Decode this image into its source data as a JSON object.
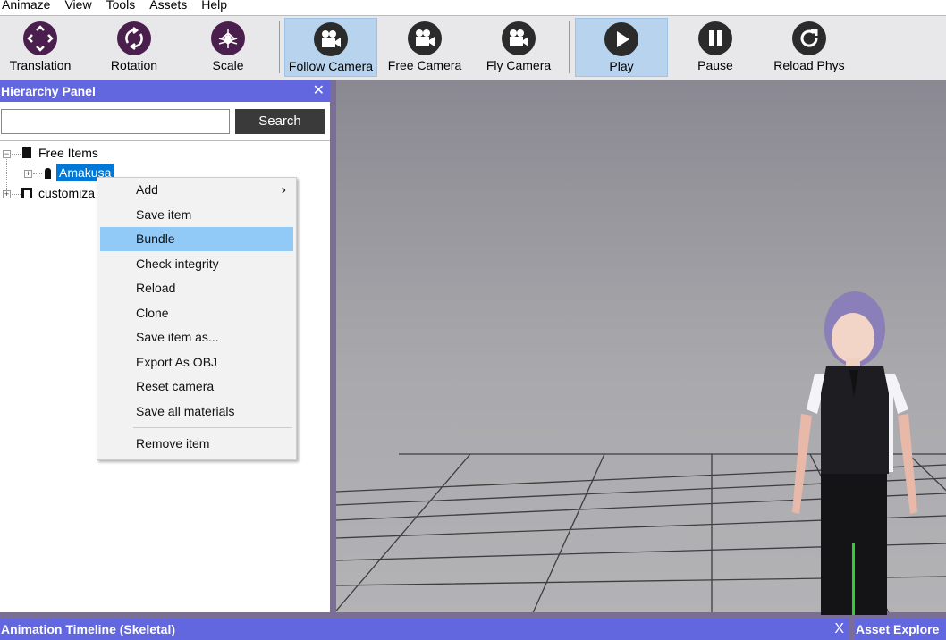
{
  "menubar": [
    "Animaze",
    "View",
    "Tools",
    "Assets",
    "Help"
  ],
  "toolbar": [
    {
      "label": "Translation",
      "icon": "move-icon",
      "active": false
    },
    {
      "label": "Rotation",
      "icon": "rotate-icon",
      "active": false
    },
    {
      "label": "Scale",
      "icon": "scale-icon",
      "active": false
    },
    {
      "label": "Follow Camera",
      "icon": "camera-icon",
      "active": true
    },
    {
      "label": "Free Camera",
      "icon": "camera-icon",
      "active": false
    },
    {
      "label": "Fly Camera",
      "icon": "camera-icon",
      "active": false
    },
    {
      "label": "Play",
      "icon": "play-icon",
      "active": true
    },
    {
      "label": "Pause",
      "icon": "pause-icon",
      "active": false
    },
    {
      "label": "Reload Phys",
      "icon": "reload-icon",
      "active": false
    }
  ],
  "hierarchy": {
    "title": "Hierarchy Panel",
    "close": "✕",
    "search_value": "",
    "search_button": "Search",
    "tree": [
      "Free Items",
      "Amakusa",
      "customiza"
    ]
  },
  "context_menu": {
    "items": [
      "Add",
      "Save item",
      "Bundle",
      "Check integrity",
      "Reload",
      "Clone",
      "Save item as...",
      "Export As OBJ",
      "Reset camera",
      "Save all materials",
      "Remove item"
    ],
    "submenu_arrow": "›",
    "highlighted": "Bundle"
  },
  "bottom": {
    "timeline_title": "Animation Timeline (Skeletal)",
    "timeline_close": "X",
    "asset_title": "Asset Explore"
  },
  "colors": {
    "header": "#6266df",
    "active": "#b7d3ee",
    "selection": "#0078d7"
  }
}
